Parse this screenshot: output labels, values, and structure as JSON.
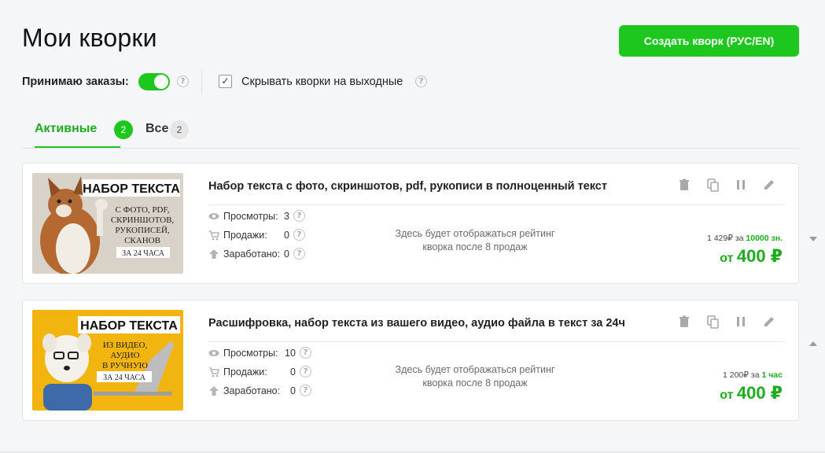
{
  "page": {
    "title": "Мои кворки",
    "create_button": "Создать кворк (РУС/EN)",
    "accent_color": "#1dc71d"
  },
  "controls": {
    "accept_orders_label": "Принимаю заказы:",
    "accept_orders_on": true,
    "hide_weekends_label": "Скрывать кворки на выходные",
    "hide_weekends_checked": true,
    "help_glyph": "?"
  },
  "tabs": [
    {
      "label": "Активные",
      "count": "2",
      "active": true
    },
    {
      "label": "Все",
      "count": "2",
      "active": false
    }
  ],
  "kworks": [
    {
      "title": "Набор текста с фото, скриншотов, pdf, рукописи в полноценный текст",
      "thumb": {
        "heading": "НАБОР ТЕКСТА",
        "lines": [
          "С ФОТО, PDF,",
          "СКРИНШОТОВ,",
          "РУКОПИСЕЙ,",
          "СКАНОВ"
        ],
        "badge": "ЗА 24 ЧАСА"
      },
      "stats": [
        {
          "icon": "eye-icon",
          "label": "Просмотры:",
          "value": "3"
        },
        {
          "icon": "cart-icon",
          "label": "Продажи:",
          "value": "0"
        },
        {
          "icon": "arrow-up-icon",
          "label": "Заработано:",
          "value": "0"
        }
      ],
      "rating_text_1": "Здесь будет отображаться рейтинг",
      "rating_text_2": "кворка после 8 продаж",
      "price_small_prefix": "1 429₽ за ",
      "price_small_unit": "10000 зн.",
      "price_from": "от ",
      "price_value": "400 ₽"
    },
    {
      "title": "Расшифровка, набор текста из вашего видео, аудио файла в текст за 24ч",
      "thumb": {
        "heading": "НАБОР ТЕКСТА",
        "lines": [
          "ИЗ ВИДЕО,",
          "АУДИО",
          "В РУЧНУЮ"
        ],
        "badge": "ЗА 24 ЧАСА"
      },
      "stats": [
        {
          "icon": "eye-icon",
          "label": "Просмотры:",
          "value": "10"
        },
        {
          "icon": "cart-icon",
          "label": "Продажи:",
          "value": "0"
        },
        {
          "icon": "arrow-up-icon",
          "label": "Заработано:",
          "value": "0"
        }
      ],
      "rating_text_1": "Здесь будет отображаться рейтинг",
      "rating_text_2": "кворка после 8 продаж",
      "price_small_prefix": "1 200₽ за ",
      "price_small_unit": "1 час",
      "price_from": "от ",
      "price_value": "400 ₽"
    }
  ],
  "actions": [
    "trash-icon",
    "copy-icon",
    "pause-icon",
    "edit-icon"
  ]
}
